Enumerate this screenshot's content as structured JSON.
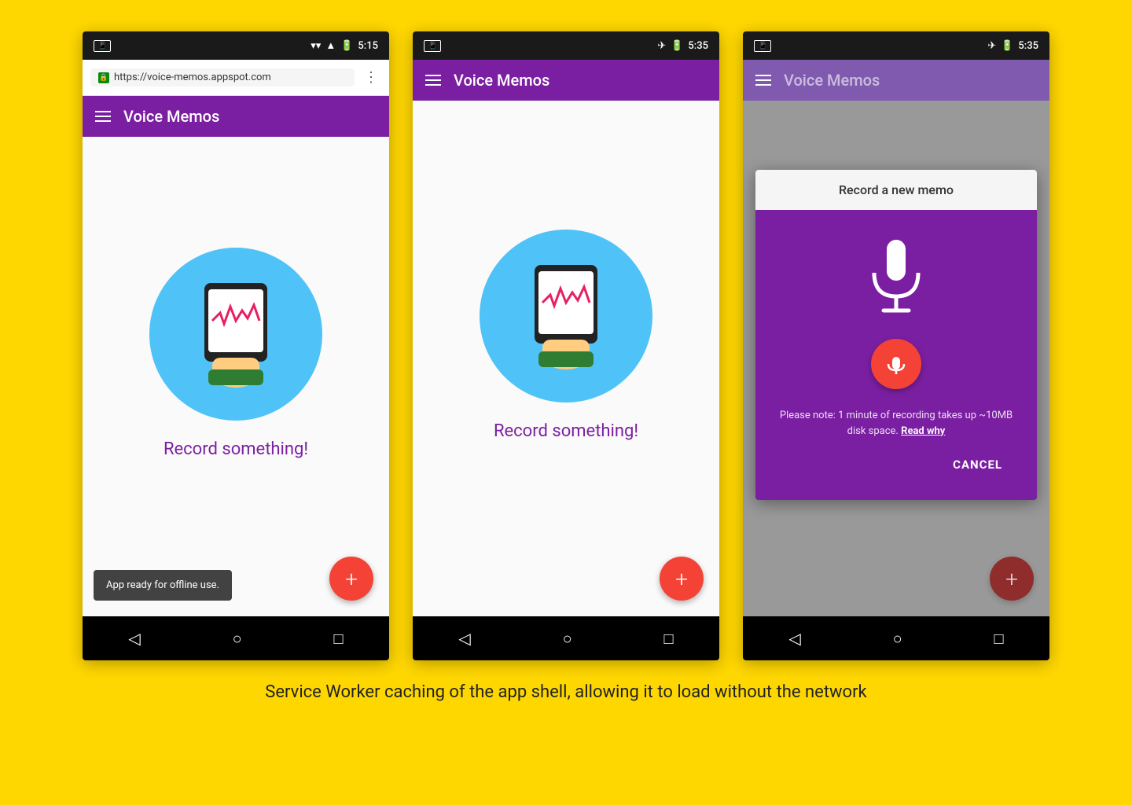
{
  "page": {
    "background": "#FFD700",
    "caption": "Service Worker caching of the app shell, allowing it to load without the network"
  },
  "phone1": {
    "status": {
      "time": "5:15",
      "icons": [
        "wifi",
        "signal",
        "battery"
      ]
    },
    "browser": {
      "url": "https://voice-memos.appspot.com",
      "lock_color": "#0a8a0a"
    },
    "toolbar": {
      "title": "Voice Memos",
      "bg": "#7B1FA2"
    },
    "content": {
      "record_label": "Record something!"
    },
    "snackbar": {
      "text": "App ready for offline use."
    },
    "fab_label": "+",
    "nav": {
      "back": "◁",
      "home": "○",
      "overview": "□"
    }
  },
  "phone2": {
    "status": {
      "time": "5:35",
      "icons": [
        "plane",
        "battery"
      ]
    },
    "toolbar": {
      "title": "Voice Memos",
      "bg": "#7B1FA2"
    },
    "content": {
      "record_label": "Record something!"
    },
    "fab_label": "+",
    "nav": {
      "back": "◁",
      "home": "○",
      "overview": "□"
    }
  },
  "phone3": {
    "status": {
      "time": "5:35",
      "icons": [
        "plane",
        "battery"
      ]
    },
    "toolbar": {
      "title": "Voice Memos",
      "bg": "#4a148c"
    },
    "dialog": {
      "title": "Record a new memo",
      "note": "Please note: 1 minute of recording takes up ~10MB disk space.",
      "read_why": "Read why",
      "cancel_label": "CANCEL"
    },
    "fab_label": "+",
    "nav": {
      "back": "◁",
      "home": "○",
      "overview": "□"
    }
  }
}
